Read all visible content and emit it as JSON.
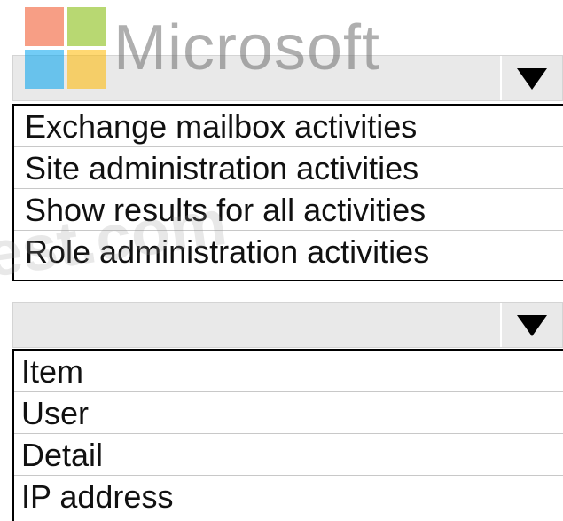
{
  "logo": {
    "wordmark": "Microsoft",
    "colors": [
      "#f25022",
      "#7fba00",
      "#00a4ef",
      "#ffb900"
    ]
  },
  "watermark": {
    "text": "test.com"
  },
  "dropdown_activities": {
    "selected": "",
    "options": [
      "Exchange mailbox activities",
      "Site administration activities",
      "Show results for all activities",
      "Role administration activities"
    ]
  },
  "dropdown_field": {
    "selected": "",
    "options": [
      "Item",
      "User",
      "Detail",
      "IP address"
    ]
  }
}
